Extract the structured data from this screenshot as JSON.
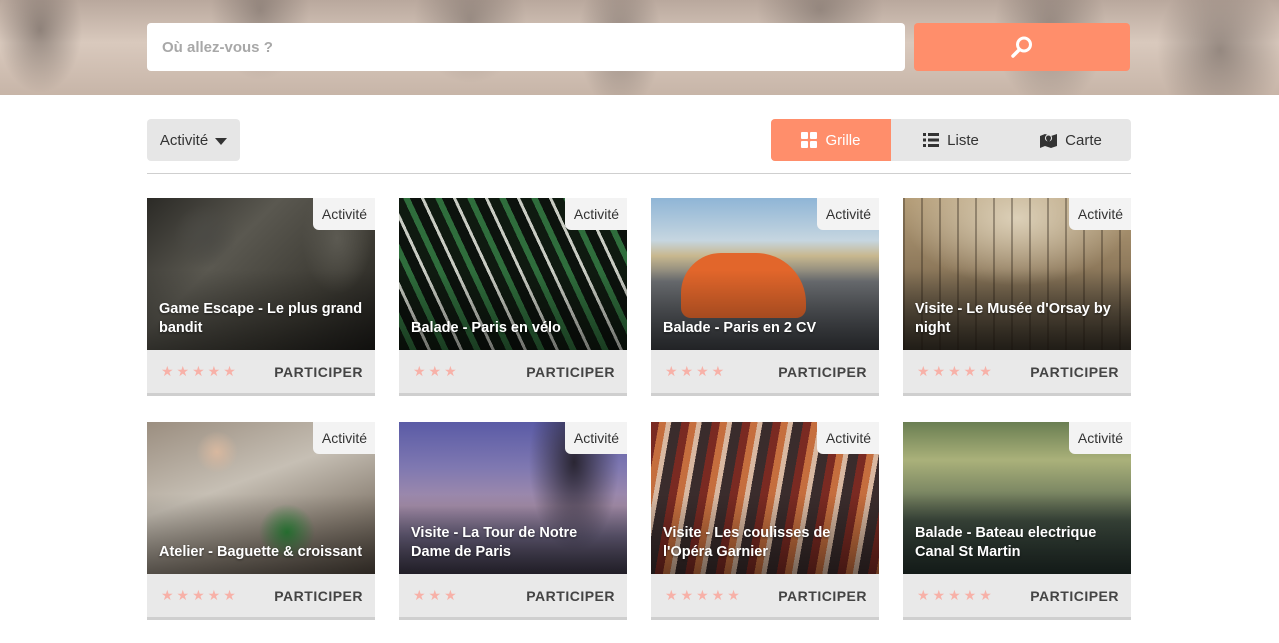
{
  "search": {
    "placeholder": "Où allez-vous ?"
  },
  "toolbar": {
    "filter_label": "Activité",
    "views": [
      {
        "label": "Grille",
        "icon": "grid-icon",
        "active": true
      },
      {
        "label": "Liste",
        "icon": "list-icon",
        "active": false
      },
      {
        "label": "Carte",
        "icon": "map-icon",
        "active": false
      }
    ]
  },
  "colors": {
    "accent": "#ff8e6b",
    "stars": "#f7b1a8",
    "panel": "#e6e6e6"
  },
  "cards": [
    {
      "badge": "Activité",
      "title": "Game Escape - Le plus grand bandit",
      "stars": "★★★★★",
      "action": "PARTICIPER"
    },
    {
      "badge": "Activité",
      "title": "Balade - Paris en vélo",
      "stars": "★★★",
      "action": "PARTICIPER"
    },
    {
      "badge": "Activité",
      "title": "Balade - Paris en 2 CV",
      "stars": "★★★★",
      "action": "PARTICIPER"
    },
    {
      "badge": "Activité",
      "title": "Visite - Le Musée d'Orsay by night",
      "stars": "★★★★★",
      "action": "PARTICIPER"
    },
    {
      "badge": "Activité",
      "title": "Atelier - Baguette & croissant",
      "stars": "★★★★★",
      "action": "PARTICIPER"
    },
    {
      "badge": "Activité",
      "title": "Visite - La Tour de Notre Dame de Paris",
      "stars": "★★★",
      "action": "PARTICIPER"
    },
    {
      "badge": "Activité",
      "title": "Visite - Les coulisses de l'Opéra Garnier",
      "stars": "★★★★★",
      "action": "PARTICIPER"
    },
    {
      "badge": "Activité",
      "title": "Balade - Bateau electrique Canal St Martin",
      "stars": "★★★★★",
      "action": "PARTICIPER"
    }
  ]
}
